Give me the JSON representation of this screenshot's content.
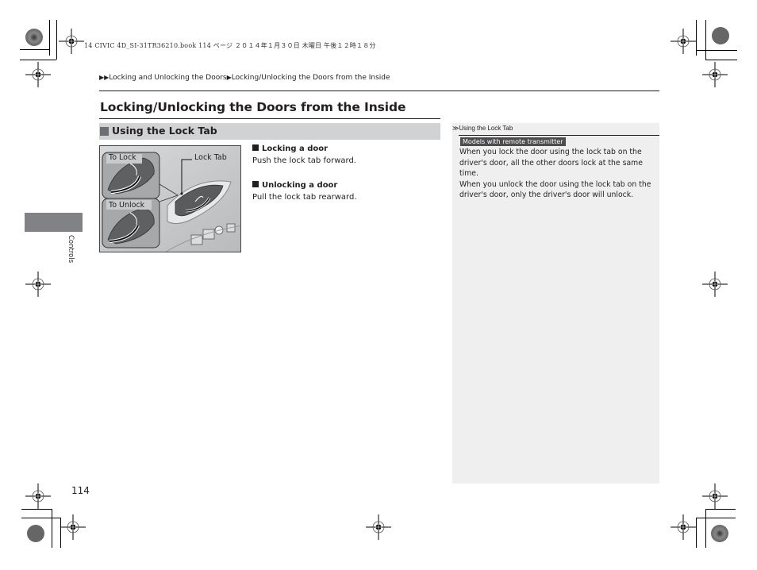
{
  "file_header": "14 CIVIC 4D_SI-31TR36210.book  114 ページ  ２０１４年１月３０日  木曜日  午後１２時１８分",
  "breadcrumb": {
    "arrow_icon": "▶▶",
    "level1": "Locking and Unlocking the Doors",
    "separator_icon": "▶",
    "level2": "Locking/Unlocking the Doors from the Inside"
  },
  "page_title": "Locking/Unlocking the Doors from the Inside",
  "section": {
    "title": "Using the Lock Tab"
  },
  "figure": {
    "callouts": {
      "to_lock": "To Lock",
      "to_unlock": "To Unlock",
      "lock_tab": "Lock Tab"
    }
  },
  "instructions": [
    {
      "heading": "Locking a door",
      "text": "Push the lock tab forward."
    },
    {
      "heading": "Unlocking a door",
      "text": "Pull the lock tab rearward."
    }
  ],
  "sidebar_note": {
    "ref_icon": "≫",
    "title": "Using the Lock Tab",
    "badge": "Models with remote transmitter",
    "paragraphs": [
      "When you lock the door using the lock tab on the driver's door, all the other doors lock at the same time.",
      "When you unlock the door using the lock tab on the driver's door, only the driver's door will unlock."
    ]
  },
  "chapter_tab": "Controls",
  "page_number": "114",
  "colors": {
    "section_bar": "#d1d2d4",
    "sidebar_bg": "#efeff0",
    "badge_bg": "#4d4d4f",
    "chapter_tab": "#808285"
  }
}
